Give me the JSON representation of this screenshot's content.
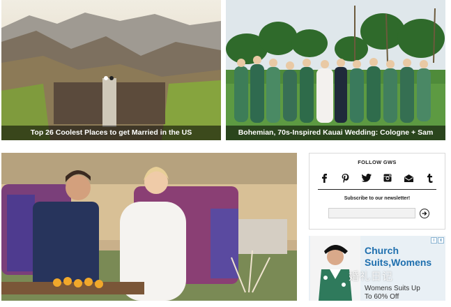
{
  "cards": [
    {
      "caption": "Top 26 Coolest Places to get Married in the US"
    },
    {
      "caption": "Bohemian, 70s-Inspired Kauai Wedding: Cologne + Sam"
    }
  ],
  "follow": {
    "title": "FOLLOW GWS",
    "social_icons": [
      "facebook-icon",
      "pinterest-icon",
      "twitter-icon",
      "instagram-icon",
      "email-icon",
      "tumblr-icon"
    ],
    "newsletter_label": "Subscribe to our newsletter!",
    "email_placeholder": ""
  },
  "ad": {
    "headline_line1": "Church",
    "headline_line2": "Suits,Womens",
    "subline1": "Womens Suits Up",
    "subline2": "To 60% Off",
    "badge_info": "i",
    "badge_close": "x",
    "accent_color": "#1e6fae"
  },
  "watermark": "婚礼日记"
}
